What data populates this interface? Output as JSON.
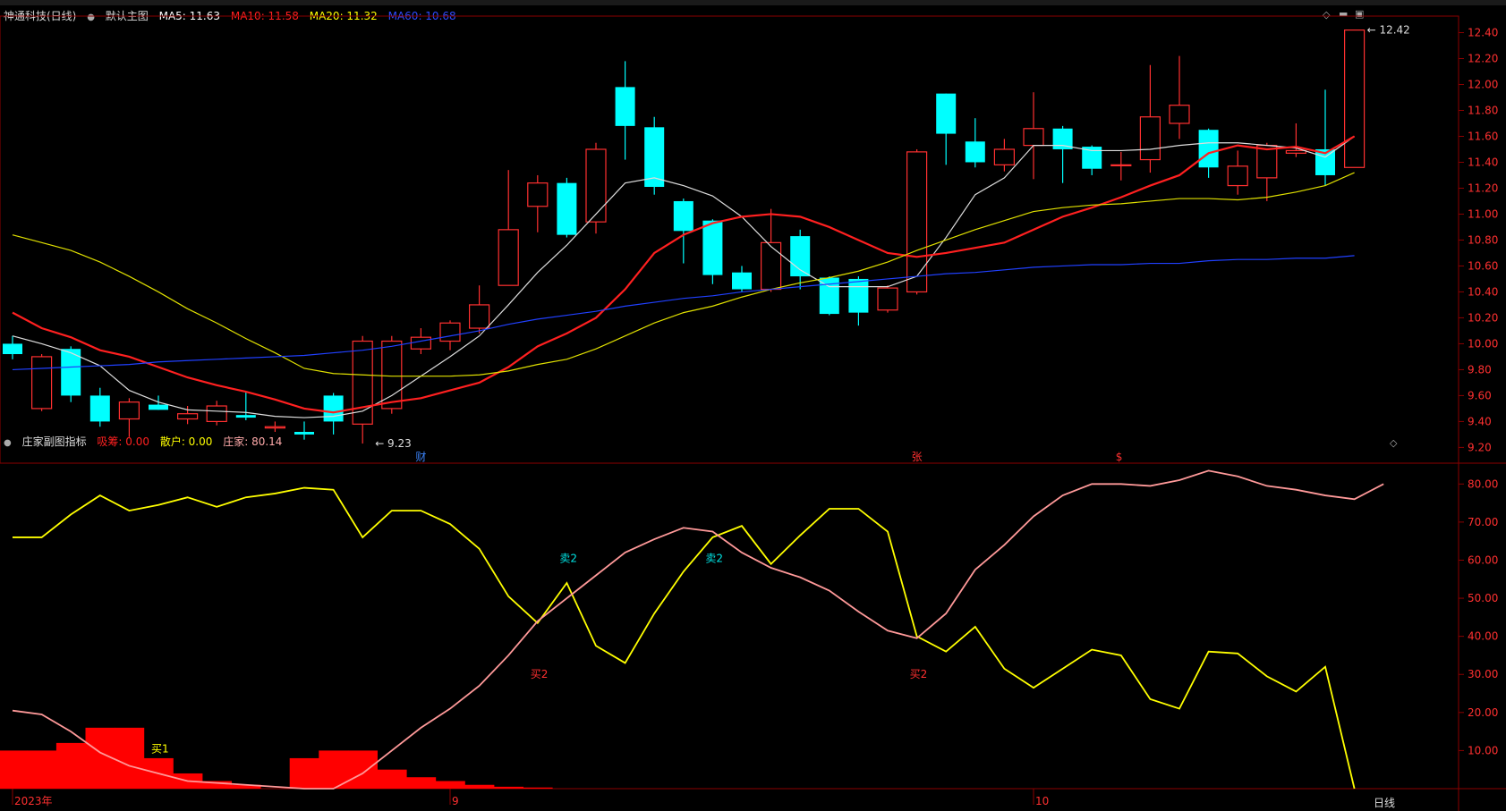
{
  "window": {
    "stock_title": "神通科技(日线)",
    "main_label": "默认主图"
  },
  "ma_legend": [
    {
      "label": "MA5: 11.63",
      "color": "#ffffff"
    },
    {
      "label": "MA10: 11.58",
      "color": "#ff2020"
    },
    {
      "label": "MA20: 11.32",
      "color": "#ffff00"
    },
    {
      "label": "MA60: 10.68",
      "color": "#2040ff"
    }
  ],
  "sub_panel": {
    "title": "庄家副图指标",
    "legend": [
      {
        "label": "吸筹: 0.00",
        "color": "#ff2020"
      },
      {
        "label": "散户: 0.00",
        "color": "#ffff00"
      },
      {
        "label": "庄家: 80.14",
        "color": "#ffaaaa"
      }
    ]
  },
  "bottom_bar": {
    "period_button": "日线"
  },
  "chart_data": [
    {
      "type": "candlestick",
      "ylim": [
        9.12,
        12.5
      ],
      "yticks": [
        "12.40",
        "12.20",
        "12.00",
        "11.80",
        "11.60",
        "11.40",
        "11.20",
        "11.00",
        "10.80",
        "10.60",
        "10.40",
        "10.20",
        "10.00",
        "9.80",
        "9.60",
        "9.40",
        "9.20"
      ],
      "candles": [
        {
          "o": 10.0,
          "c": 9.92,
          "h": 10.06,
          "l": 9.88
        },
        {
          "o": 9.5,
          "c": 9.9,
          "h": 9.92,
          "l": 9.48
        },
        {
          "o": 9.96,
          "c": 9.6,
          "h": 9.98,
          "l": 9.55
        },
        {
          "o": 9.6,
          "c": 9.4,
          "h": 9.66,
          "l": 9.36
        },
        {
          "o": 9.42,
          "c": 9.55,
          "h": 9.58,
          "l": 9.28
        },
        {
          "o": 9.53,
          "c": 9.49,
          "h": 9.6,
          "l": 9.49
        },
        {
          "o": 9.42,
          "c": 9.46,
          "h": 9.52,
          "l": 9.38
        },
        {
          "o": 9.4,
          "c": 9.52,
          "h": 9.56,
          "l": 9.37
        },
        {
          "o": 9.45,
          "c": 9.43,
          "h": 9.63,
          "l": 9.41
        },
        {
          "o": 9.35,
          "c": 9.36,
          "h": 9.4,
          "l": 9.32
        },
        {
          "o": 9.32,
          "c": 9.3,
          "h": 9.4,
          "l": 9.26
        },
        {
          "o": 9.6,
          "c": 9.4,
          "h": 9.62,
          "l": 9.3
        },
        {
          "o": 9.38,
          "c": 10.02,
          "h": 10.06,
          "l": 9.23
        },
        {
          "o": 9.5,
          "c": 10.02,
          "h": 10.06,
          "l": 9.46
        },
        {
          "o": 9.96,
          "c": 10.05,
          "h": 10.12,
          "l": 9.92
        },
        {
          "o": 10.02,
          "c": 10.16,
          "h": 10.18,
          "l": 9.95
        },
        {
          "o": 10.12,
          "c": 10.3,
          "h": 10.45,
          "l": 10.08
        },
        {
          "o": 10.45,
          "c": 10.88,
          "h": 11.34,
          "l": 10.45
        },
        {
          "o": 11.06,
          "c": 11.24,
          "h": 11.3,
          "l": 10.86
        },
        {
          "o": 11.24,
          "c": 10.84,
          "h": 11.28,
          "l": 10.82
        },
        {
          "o": 10.94,
          "c": 11.5,
          "h": 11.55,
          "l": 10.85
        },
        {
          "o": 11.98,
          "c": 11.68,
          "h": 12.18,
          "l": 11.42
        },
        {
          "o": 11.67,
          "c": 11.21,
          "h": 11.75,
          "l": 11.15
        },
        {
          "o": 11.1,
          "c": 10.87,
          "h": 11.12,
          "l": 10.62
        },
        {
          "o": 10.95,
          "c": 10.53,
          "h": 10.96,
          "l": 10.46
        },
        {
          "o": 10.55,
          "c": 10.42,
          "h": 10.6,
          "l": 10.4
        },
        {
          "o": 10.42,
          "c": 10.78,
          "h": 11.04,
          "l": 10.4
        },
        {
          "o": 10.83,
          "c": 10.52,
          "h": 10.88,
          "l": 10.42
        },
        {
          "o": 10.51,
          "c": 10.23,
          "h": 10.52,
          "l": 10.22
        },
        {
          "o": 10.5,
          "c": 10.24,
          "h": 10.52,
          "l": 10.14
        },
        {
          "o": 10.26,
          "c": 10.43,
          "h": 10.45,
          "l": 10.24
        },
        {
          "o": 10.4,
          "c": 11.48,
          "h": 11.5,
          "l": 10.38
        },
        {
          "o": 11.93,
          "c": 11.62,
          "h": 11.93,
          "l": 11.38
        },
        {
          "o": 11.56,
          "c": 11.4,
          "h": 11.74,
          "l": 11.36
        },
        {
          "o": 11.38,
          "c": 11.5,
          "h": 11.58,
          "l": 11.33
        },
        {
          "o": 11.53,
          "c": 11.66,
          "h": 11.94,
          "l": 11.27
        },
        {
          "o": 11.66,
          "c": 11.5,
          "h": 11.68,
          "l": 11.24
        },
        {
          "o": 11.52,
          "c": 11.35,
          "h": 11.53,
          "l": 11.3
        },
        {
          "o": 11.38,
          "c": 11.38,
          "h": 11.48,
          "l": 11.26
        },
        {
          "o": 11.42,
          "c": 11.75,
          "h": 12.15,
          "l": 11.32
        },
        {
          "o": 11.7,
          "c": 11.84,
          "h": 12.22,
          "l": 11.58
        },
        {
          "o": 11.65,
          "c": 11.36,
          "h": 11.66,
          "l": 11.28
        },
        {
          "o": 11.22,
          "c": 11.37,
          "h": 11.49,
          "l": 11.15
        },
        {
          "o": 11.28,
          "c": 11.53,
          "h": 11.55,
          "l": 11.1
        },
        {
          "o": 11.47,
          "c": 11.49,
          "h": 11.7,
          "l": 11.44
        },
        {
          "o": 11.5,
          "c": 11.3,
          "h": 11.96,
          "l": 11.22
        },
        {
          "o": 11.36,
          "c": 12.42,
          "h": 12.42,
          "l": 11.36
        }
      ],
      "series": [
        {
          "name": "MA5",
          "color": "#dddddd",
          "values": [
            10.06,
            10.0,
            9.93,
            9.83,
            9.64,
            9.55,
            9.49,
            9.48,
            9.47,
            9.44,
            9.43,
            9.44,
            9.48,
            9.6,
            9.75,
            9.9,
            10.06,
            10.3,
            10.55,
            10.76,
            11.0,
            11.24,
            11.28,
            11.22,
            11.14,
            10.98,
            10.75,
            10.57,
            10.44,
            10.44,
            10.44,
            10.52,
            10.82,
            11.15,
            11.28,
            11.53,
            11.53,
            11.49,
            11.49,
            11.5,
            11.53,
            11.55,
            11.55,
            11.53,
            11.51,
            11.44,
            11.6
          ]
        },
        {
          "name": "MA10",
          "color": "#ff2020",
          "values": [
            10.24,
            10.12,
            10.05,
            9.95,
            9.9,
            9.82,
            9.74,
            9.68,
            9.63,
            9.57,
            9.5,
            9.47,
            9.51,
            9.55,
            9.58,
            9.64,
            9.7,
            9.82,
            9.98,
            10.08,
            10.2,
            10.42,
            10.7,
            10.84,
            10.93,
            10.98,
            11.0,
            10.98,
            10.9,
            10.8,
            10.7,
            10.67,
            10.7,
            10.74,
            10.78,
            10.88,
            10.98,
            11.05,
            11.13,
            11.22,
            11.3,
            11.47,
            11.53,
            11.5,
            11.52,
            11.47,
            11.6
          ]
        },
        {
          "name": "MA20",
          "color": "#e0e000",
          "values": [
            10.84,
            10.78,
            10.72,
            10.63,
            10.52,
            10.4,
            10.27,
            10.16,
            10.04,
            9.93,
            9.81,
            9.77,
            9.76,
            9.75,
            9.75,
            9.75,
            9.76,
            9.79,
            9.84,
            9.88,
            9.96,
            10.06,
            10.16,
            10.24,
            10.29,
            10.36,
            10.42,
            10.47,
            10.51,
            10.56,
            10.63,
            10.72,
            10.8,
            10.88,
            10.95,
            11.02,
            11.05,
            11.07,
            11.08,
            11.1,
            11.12,
            11.12,
            11.11,
            11.13,
            11.17,
            11.22,
            11.32
          ]
        },
        {
          "name": "MA60",
          "color": "#2040ff",
          "values": [
            9.8,
            9.81,
            9.82,
            9.83,
            9.84,
            9.86,
            9.87,
            9.88,
            9.89,
            9.9,
            9.91,
            9.93,
            9.95,
            9.98,
            10.02,
            10.06,
            10.1,
            10.15,
            10.19,
            10.22,
            10.25,
            10.29,
            10.32,
            10.35,
            10.37,
            10.4,
            10.42,
            10.44,
            10.46,
            10.48,
            10.5,
            10.52,
            10.54,
            10.55,
            10.57,
            10.59,
            10.6,
            10.61,
            10.61,
            10.62,
            10.62,
            10.64,
            10.65,
            10.65,
            10.66,
            10.66,
            10.68
          ]
        }
      ],
      "annotations": [
        {
          "label": "9.23",
          "index": 12,
          "price": 9.23
        },
        {
          "label": "12.42",
          "index": 46,
          "price": 12.42
        }
      ],
      "event_markers": [
        {
          "label": "财",
          "index": 14,
          "color": "#3b82f6"
        },
        {
          "label": "张",
          "index": 31,
          "color": "#ff3030"
        },
        {
          "label": "$",
          "index": 38,
          "color": "#ff3030"
        }
      ]
    },
    {
      "type": "line",
      "ylim": [
        0,
        85
      ],
      "yticks": [
        "80.00",
        "70.00",
        "60.00",
        "50.00",
        "40.00",
        "30.00",
        "20.00",
        "10.00"
      ],
      "x_labels": [
        {
          "label": "2023年",
          "index": 0
        },
        {
          "label": "9",
          "index": 15
        },
        {
          "label": "10",
          "index": 35
        }
      ],
      "series": [
        {
          "name": "散户",
          "color": "#ffff00",
          "values": [
            66,
            66,
            72,
            77,
            73,
            74.5,
            76.5,
            74,
            76.5,
            77.5,
            79,
            78.5,
            66,
            73,
            73,
            69.5,
            63,
            50.5,
            43.5,
            54,
            37.5,
            33,
            46,
            57,
            66,
            69,
            59,
            66.5,
            73.5,
            73.5,
            67.5,
            40,
            36,
            42.5,
            31.5,
            26.5,
            31.5,
            36.5,
            35,
            23.5,
            21,
            36,
            35.5,
            29.5,
            25.5,
            32,
            0
          ]
        },
        {
          "name": "庄家",
          "color": "#ff9999",
          "values": [
            20.5,
            19.5,
            15,
            9.5,
            6,
            4,
            2,
            1.5,
            1,
            0.5,
            0,
            0,
            4,
            10,
            16,
            21,
            27,
            35,
            44,
            50,
            56,
            62,
            65.5,
            68.5,
            67.5,
            62,
            58,
            55.5,
            52,
            46.5,
            41.5,
            39.5,
            46,
            57.5,
            64,
            71.5,
            77,
            80,
            80,
            79.5,
            81,
            83.5,
            82,
            79.5,
            78.5,
            77,
            76,
            80
          ]
        },
        {
          "name": "吸筹",
          "color": "#ff0000",
          "values": [
            10,
            10,
            12,
            16,
            16,
            8,
            4,
            2,
            1,
            0,
            8,
            10,
            10,
            5,
            3,
            2,
            1,
            0.5,
            0.3,
            0,
            0,
            0,
            0,
            0,
            0,
            0,
            0,
            0,
            0,
            0,
            0,
            0,
            0,
            0,
            0,
            0,
            0,
            0,
            0,
            0,
            0,
            0,
            0,
            0,
            0,
            0,
            0
          ]
        }
      ],
      "labels": [
        {
          "label": "买1",
          "color": "#ffff00",
          "index": 5,
          "value": 10.5
        },
        {
          "label": "卖2",
          "color": "#00e5e5",
          "index": 19,
          "value": 60.5
        },
        {
          "label": "卖2",
          "color": "#00e5e5",
          "index": 24,
          "value": 60.5
        },
        {
          "label": "买2",
          "color": "#ff3030",
          "index": 18,
          "value": 30
        },
        {
          "label": "买2",
          "color": "#ff3030",
          "index": 31,
          "value": 30
        }
      ]
    }
  ]
}
